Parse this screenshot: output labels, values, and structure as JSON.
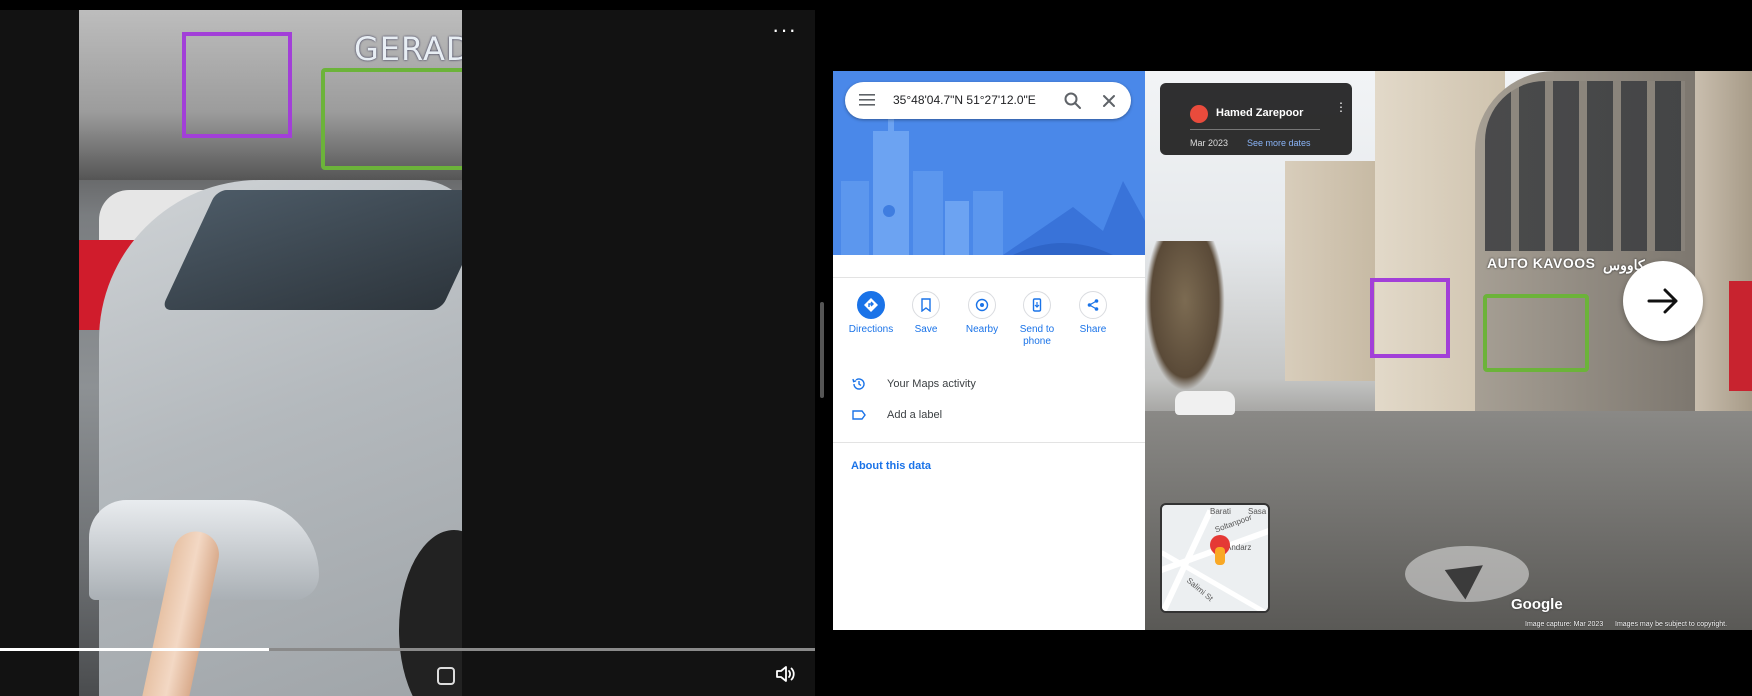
{
  "video": {
    "progress_fraction": 0.33,
    "overlay_sign_text": "GERAD"
  },
  "maps": {
    "search": {
      "value": "35°48'04.7\"N 51°27'12.0\"E"
    },
    "actions": [
      {
        "label": "Directions",
        "icon": "directions-icon"
      },
      {
        "label": "Save",
        "icon": "bookmark-icon"
      },
      {
        "label": "Nearby",
        "icon": "nearby-icon"
      },
      {
        "label": "Send to phone",
        "icon": "send-to-phone-icon"
      },
      {
        "label": "Share",
        "icon": "share-icon"
      }
    ],
    "list": [
      {
        "label": "Your Maps activity",
        "icon": "history-icon"
      },
      {
        "label": "Add a label",
        "icon": "label-icon"
      }
    ],
    "about_link": "About this data",
    "streetview": {
      "author": "Hamed Zarepoor",
      "date": "Mar 2023",
      "see_more": "See more dates",
      "sign_text": "AUTO KAVOOS",
      "sign_text_alt": "کاووس",
      "google_logo": "Google",
      "footer_capture": "Image capture: Mar 2023",
      "footer_rights": "Images may be subject to copyright."
    },
    "minimap": {
      "labels": [
        "Andarz",
        "Salimi St",
        "Barati",
        "Soltanpoor",
        "Sasa"
      ]
    }
  },
  "colors": {
    "accent_blue": "#1a73e8",
    "highlight_purple": "#a23fd8",
    "highlight_green": "#6cb33a"
  }
}
